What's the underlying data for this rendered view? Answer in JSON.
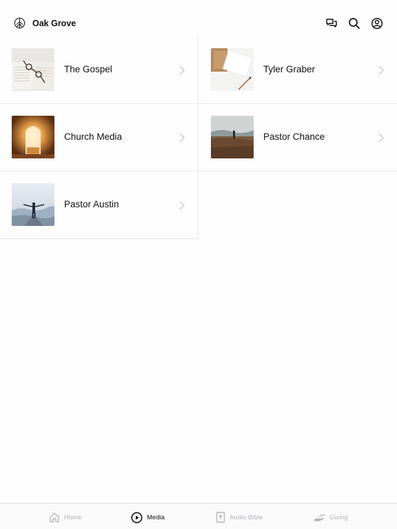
{
  "header": {
    "brand_icon": "tree-logo-icon",
    "title": "Oak Grove",
    "actions": [
      {
        "icon": "chat-bubbles-icon"
      },
      {
        "icon": "search-icon"
      },
      {
        "icon": "profile-icon"
      }
    ]
  },
  "collections": [
    {
      "label": "The Gospel",
      "thumb": "open-book-with-glasses"
    },
    {
      "label": "Tyler Graber",
      "thumb": "notepad-and-pen"
    },
    {
      "label": "Church Media",
      "thumb": "empty-tomb"
    },
    {
      "label": "Pastor Chance",
      "thumb": "person-on-hill"
    },
    {
      "label": "Pastor Austin",
      "thumb": "person-arms-outstretched"
    }
  ],
  "tabs": [
    {
      "label": "Home",
      "icon": "home-icon",
      "active": false
    },
    {
      "label": "Media",
      "icon": "play-circle-icon",
      "active": true
    },
    {
      "label": "Audio Bible",
      "icon": "bible-icon",
      "active": false
    },
    {
      "label": "Giving",
      "icon": "giving-hand-icon",
      "active": false
    }
  ],
  "colors": {
    "background": "#fdfdfe",
    "divider": "#e8e8ec",
    "text": "#111111",
    "inactive_tab": "#b4b4ba",
    "chevron": "#c8c8ce"
  }
}
